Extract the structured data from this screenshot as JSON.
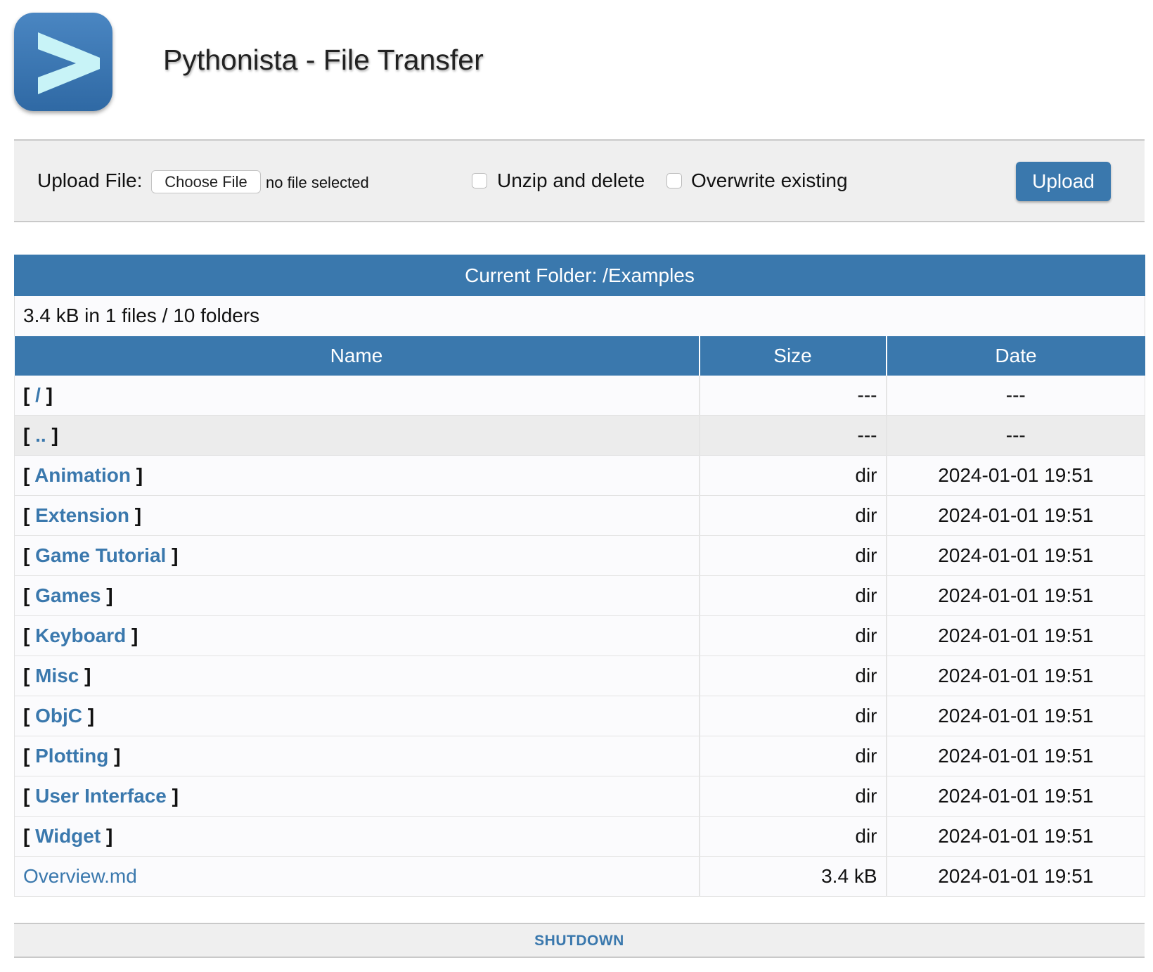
{
  "header": {
    "title": "Pythonista - File Transfer",
    "icon": "pythonista-app-icon"
  },
  "upload": {
    "label": "Upload File:",
    "choose_label": "Choose File",
    "no_file_text": "no file selected",
    "unzip_label": "Unzip and delete",
    "unzip_checked": false,
    "overwrite_label": "Overwrite existing",
    "overwrite_checked": false,
    "upload_button": "Upload"
  },
  "listing": {
    "folder_title": "Current Folder: /Examples",
    "summary": "3.4 kB in 1 files / 10 folders",
    "columns": [
      "Name",
      "Size",
      "Date"
    ],
    "rows": [
      {
        "open": "[ ",
        "name": "/",
        "close": " ]",
        "size": "---",
        "date": "---"
      },
      {
        "open": "[ ",
        "name": "..",
        "close": " ]",
        "size": "---",
        "date": "---"
      },
      {
        "open": "[ ",
        "name": "Animation",
        "close": " ]",
        "size": "dir",
        "date": "2024-01-01 19:51"
      },
      {
        "open": "[ ",
        "name": "Extension",
        "close": " ]",
        "size": "dir",
        "date": "2024-01-01 19:51"
      },
      {
        "open": "[ ",
        "name": "Game Tutorial",
        "close": " ]",
        "size": "dir",
        "date": "2024-01-01 19:51"
      },
      {
        "open": "[ ",
        "name": "Games",
        "close": " ]",
        "size": "dir",
        "date": "2024-01-01 19:51"
      },
      {
        "open": "[ ",
        "name": "Keyboard",
        "close": " ]",
        "size": "dir",
        "date": "2024-01-01 19:51"
      },
      {
        "open": "[ ",
        "name": "Misc",
        "close": " ]",
        "size": "dir",
        "date": "2024-01-01 19:51"
      },
      {
        "open": "[ ",
        "name": "ObjC",
        "close": " ]",
        "size": "dir",
        "date": "2024-01-01 19:51"
      },
      {
        "open": "[ ",
        "name": "Plotting",
        "close": " ]",
        "size": "dir",
        "date": "2024-01-01 19:51"
      },
      {
        "open": "[ ",
        "name": "User Interface",
        "close": " ]",
        "size": "dir",
        "date": "2024-01-01 19:51"
      },
      {
        "open": "[ ",
        "name": "Widget",
        "close": " ]",
        "size": "dir",
        "date": "2024-01-01 19:51"
      },
      {
        "open": "",
        "name": "Overview.md",
        "close": "",
        "size": "3.4 kB",
        "date": "2024-01-01 19:51"
      }
    ]
  },
  "footer": {
    "shutdown_label": "SHUTDOWN"
  },
  "colors": {
    "accent": "#3a78ad",
    "bar_background": "#efefef",
    "alt_row": "#ececec"
  }
}
